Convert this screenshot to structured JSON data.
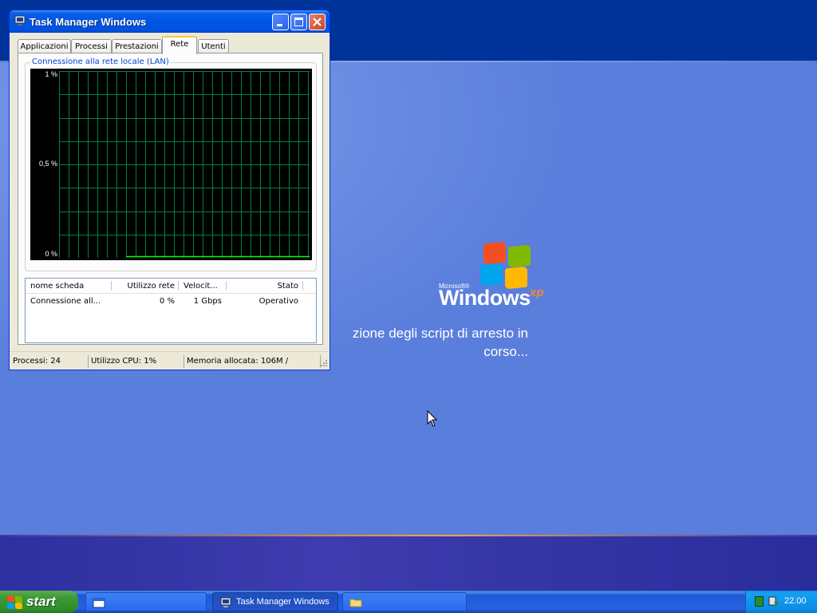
{
  "desktop": {
    "logo": {
      "microsoft": "Microsoft®",
      "windows": "Windows",
      "xp": "xp"
    },
    "status_line1": "zione degli script di arresto in",
    "status_line2": "corso...",
    "colors": {
      "background": "#5a7edc",
      "top_band": "#003399",
      "bottom_band": "#2e2fa0"
    }
  },
  "task_manager": {
    "title": "Task Manager Windows",
    "tabs": [
      {
        "label": "Applicazioni",
        "active": false
      },
      {
        "label": "Processi",
        "active": false
      },
      {
        "label": "Prestazioni",
        "active": false
      },
      {
        "label": "Rete",
        "active": true
      },
      {
        "label": "Utenti",
        "active": false
      }
    ],
    "group_title": "Connessione alla rete locale (LAN)",
    "graph": {
      "y_labels": [
        "1 %",
        "0,5 %",
        "0 %"
      ],
      "colors": {
        "background": "#000000",
        "grid": "#008040",
        "line": "#00ff00"
      }
    },
    "adapters": {
      "columns": [
        "nome scheda",
        "Utilizzo rete",
        "Velocit...",
        "Stato"
      ],
      "rows": [
        {
          "name": "Connessione all...",
          "usage": "0 %",
          "speed": "1 Gbps",
          "state": "Operativo"
        }
      ]
    },
    "status_bar": {
      "processes": "Processi: 24",
      "cpu": "Utilizzo CPU: 1%",
      "memory": "Memoria allocata: 106M /"
    }
  },
  "taskbar": {
    "start_label": "start",
    "buttons": [
      {
        "label": "",
        "icon": "window-icon",
        "active": false
      },
      {
        "label": "Task Manager Windows",
        "icon": "task-manager-icon",
        "active": true
      },
      {
        "label": "",
        "icon": "folder-icon",
        "active": false
      }
    ],
    "clock": "22.00"
  }
}
